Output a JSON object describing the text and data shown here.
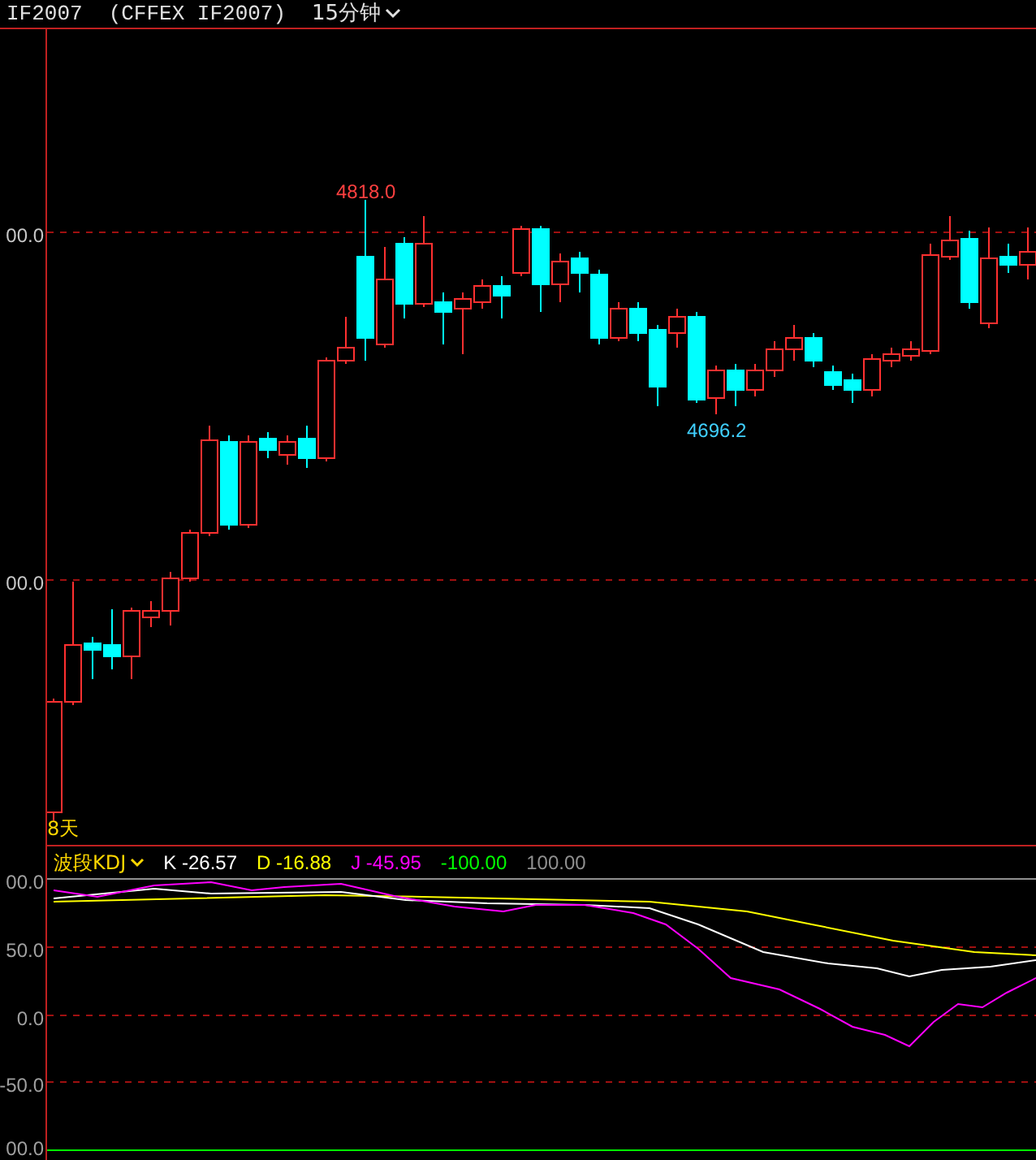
{
  "header": {
    "symbol": "IF2007",
    "exchange": "(CFFEX IF2007)",
    "period": "15分钟"
  },
  "price_axis": {
    "labels": [
      "00.0",
      "00.0"
    ]
  },
  "price_annotations": [
    {
      "text": "4818.0",
      "kind": "high"
    },
    {
      "text": "4696.2",
      "kind": "low"
    }
  ],
  "period_label": "8天",
  "indicator": {
    "name": "波段KDJ",
    "values": [
      {
        "label": "K -26.57",
        "color": "#ffffff"
      },
      {
        "label": "D -16.88",
        "color": "#ffff00"
      },
      {
        "label": "J -45.95",
        "color": "#ff00ff"
      },
      {
        "label": "-100.00",
        "color": "#00ff00"
      },
      {
        "label": "100.00",
        "color": "#909090"
      }
    ]
  },
  "indicator_axis": {
    "labels": [
      "00.0",
      "50.0",
      "0.0",
      "-50.0",
      "00.0"
    ]
  }
}
